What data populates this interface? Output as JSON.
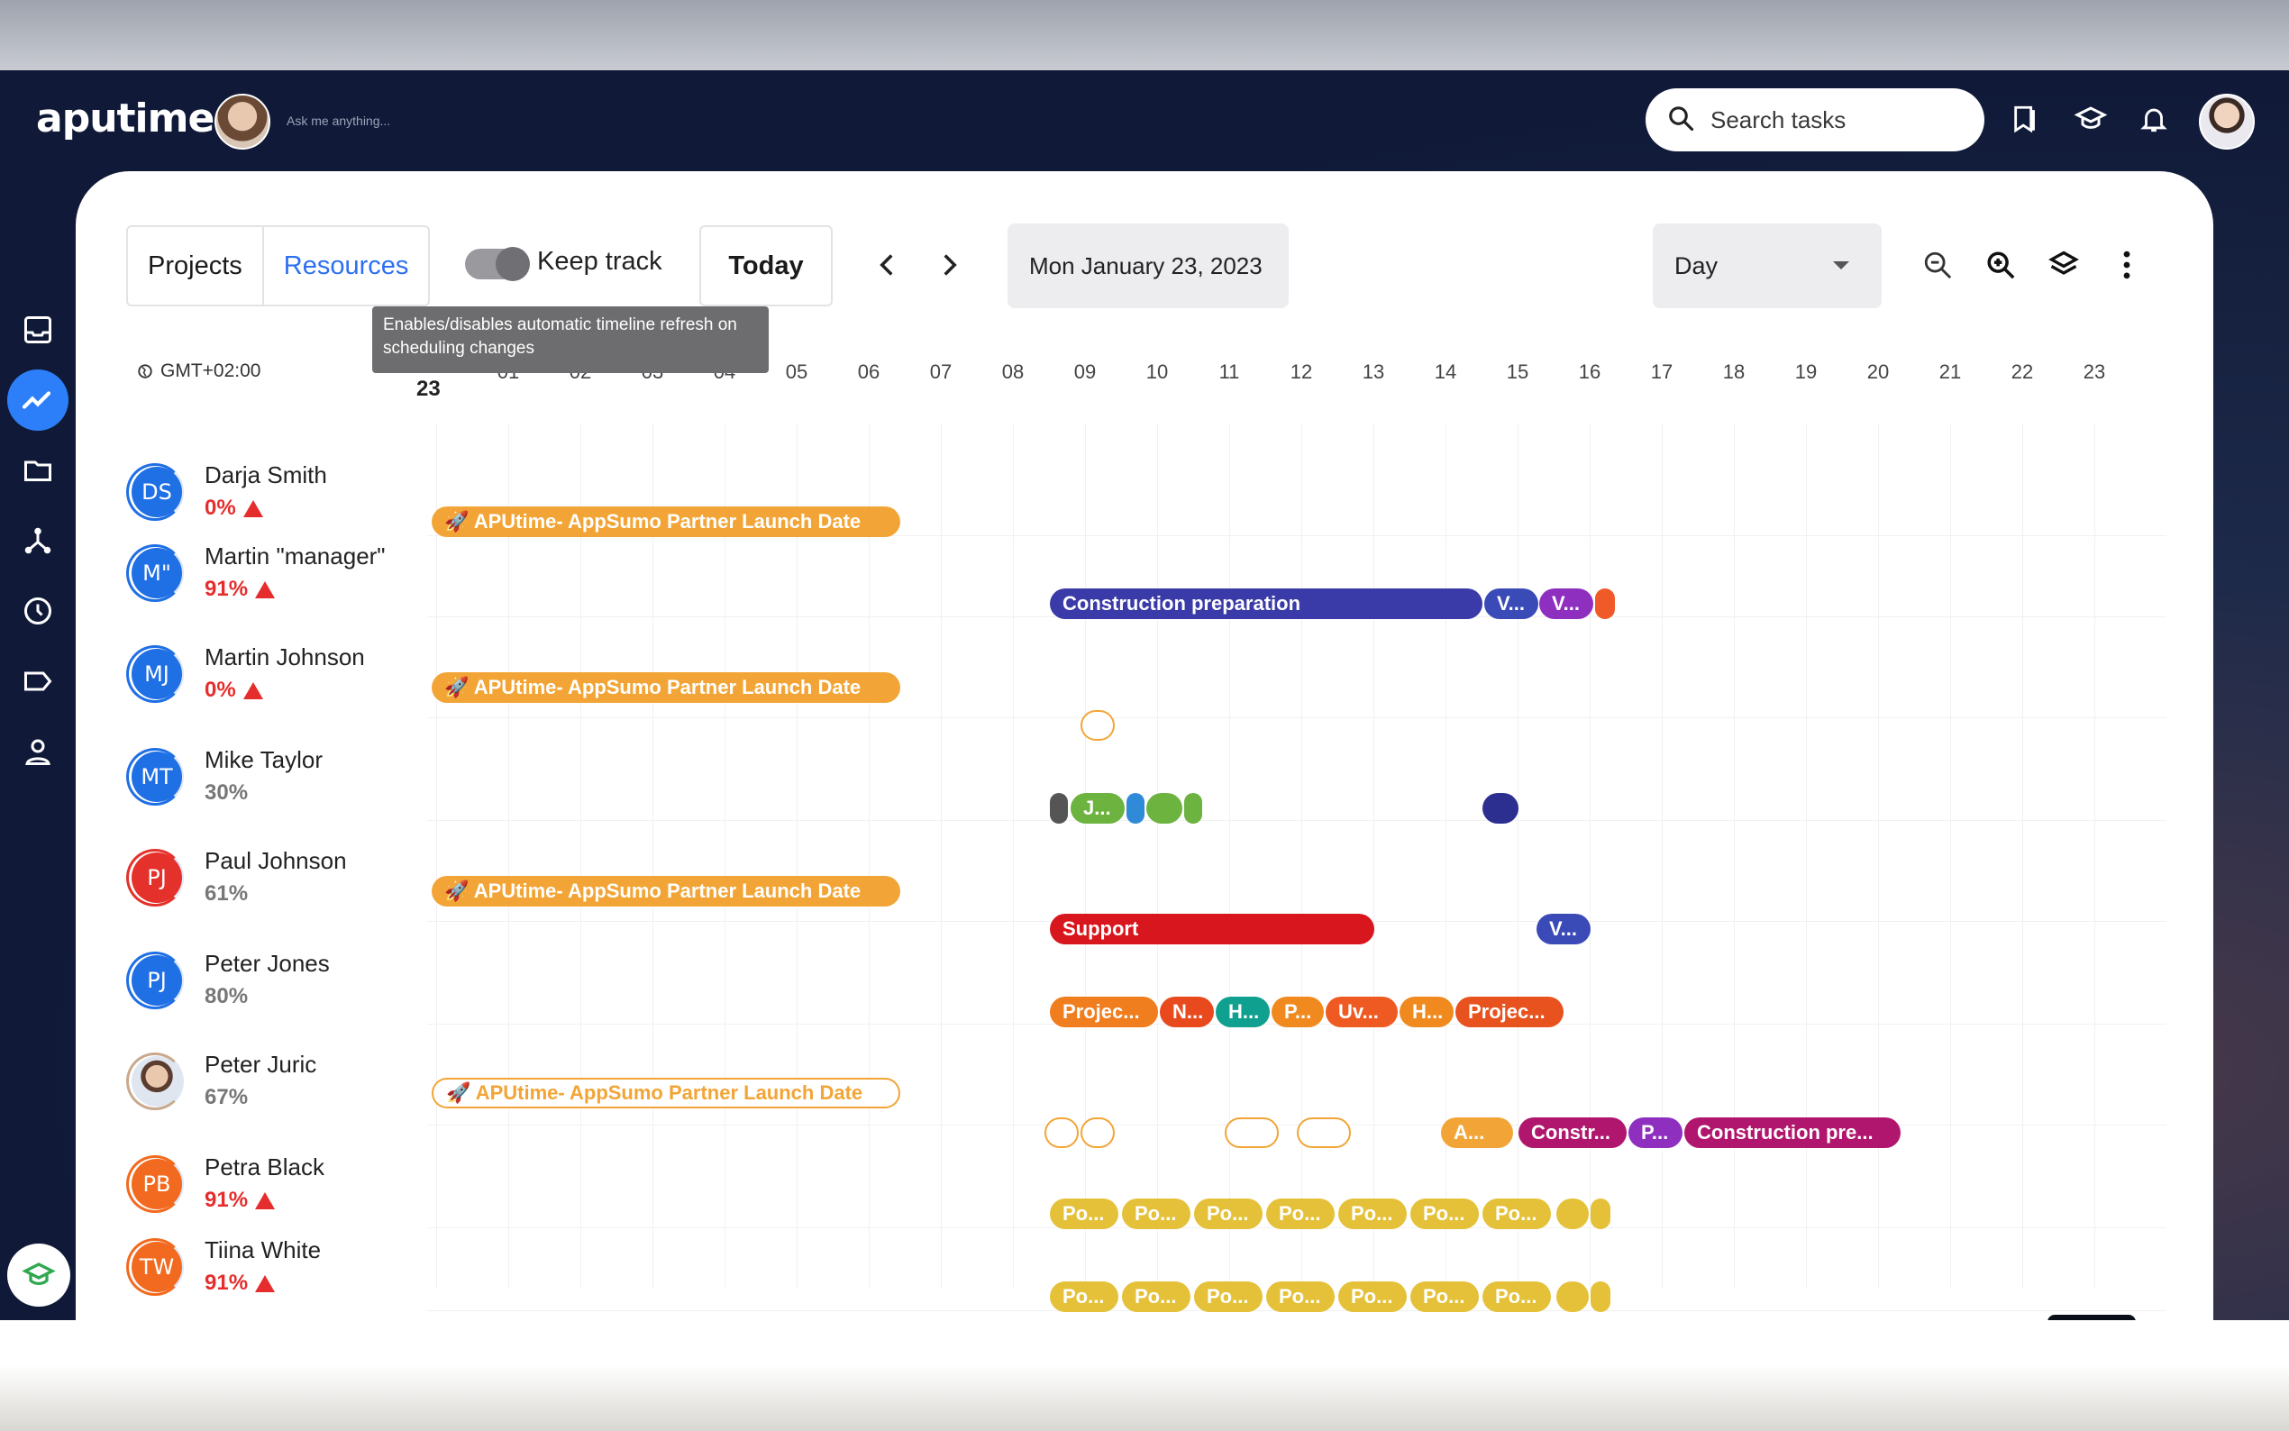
{
  "header": {
    "logo": "aputime",
    "ask_placeholder": "Ask me anything...",
    "search_label": "Search tasks"
  },
  "toolbar": {
    "projects_tab": "Projects",
    "resources_tab": "Resources",
    "keep_track_label": "Keep track",
    "today_button": "Today",
    "date_value": "Mon January 23, 2023",
    "view_value": "Day",
    "tooltip": "Enables/disables automatic timeline refresh on scheduling changes"
  },
  "timeline": {
    "timezone": "GMT+02:00",
    "first_day": "23",
    "hours": [
      "01",
      "02",
      "03",
      "04",
      "05",
      "06",
      "07",
      "08",
      "09",
      "10",
      "11",
      "12",
      "13",
      "14",
      "15",
      "16",
      "17",
      "18",
      "19",
      "20",
      "21",
      "22",
      "23"
    ]
  },
  "resources": [
    {
      "initials": "DS",
      "name": "Darja Smith",
      "pct": "0%",
      "warn": true,
      "color": "#1f6fe5"
    },
    {
      "initials": "M\"",
      "name": "Martin \"manager\"",
      "pct": "91%",
      "warn": true,
      "color": "#1f6fe5"
    },
    {
      "initials": "MJ",
      "name": "Martin Johnson",
      "pct": "0%",
      "warn": true,
      "color": "#1f6fe5"
    },
    {
      "initials": "MT",
      "name": "Mike Taylor",
      "pct": "30%",
      "warn": false,
      "color": "#1f6fe5"
    },
    {
      "initials": "PJ",
      "name": "Paul Johnson",
      "pct": "61%",
      "warn": false,
      "color": "#e5312b"
    },
    {
      "initials": "PJ",
      "name": "Peter Jones",
      "pct": "80%",
      "warn": false,
      "color": "#1f6fe5"
    },
    {
      "initials": "",
      "name": "Peter Juric",
      "pct": "67%",
      "warn": false,
      "color": "#c9a98e"
    },
    {
      "initials": "PB",
      "name": "Petra Black",
      "pct": "91%",
      "warn": true,
      "color": "#f26a1f"
    },
    {
      "initials": "TW",
      "name": "Tiina White",
      "pct": "91%",
      "warn": true,
      "color": "#f26a1f"
    }
  ],
  "tasks": {
    "launch": "🚀 APUtime- AppSumo Partner Launch Date",
    "construction_prep": "Construction preparation",
    "v1": "V...",
    "v2": "V...",
    "j": "J...",
    "support": "Support",
    "v3": "V...",
    "jones": [
      "Projec...",
      "N...",
      "H...",
      "P...",
      "Uv...",
      "H...",
      "Projec..."
    ],
    "juric_a": "A...",
    "juric_constr": "Constr...",
    "juric_p": "P...",
    "juric_cp": "Construction pre...",
    "po": "Po..."
  },
  "colors": {
    "accent": "#2d6ff2",
    "launch": "#f2a536",
    "navy": "#3a3aa8",
    "purple": "#8e2fc0",
    "red": "#d8161d",
    "green": "#6cb33f",
    "yellow": "#e5c13a",
    "magenta": "#b0166d"
  }
}
